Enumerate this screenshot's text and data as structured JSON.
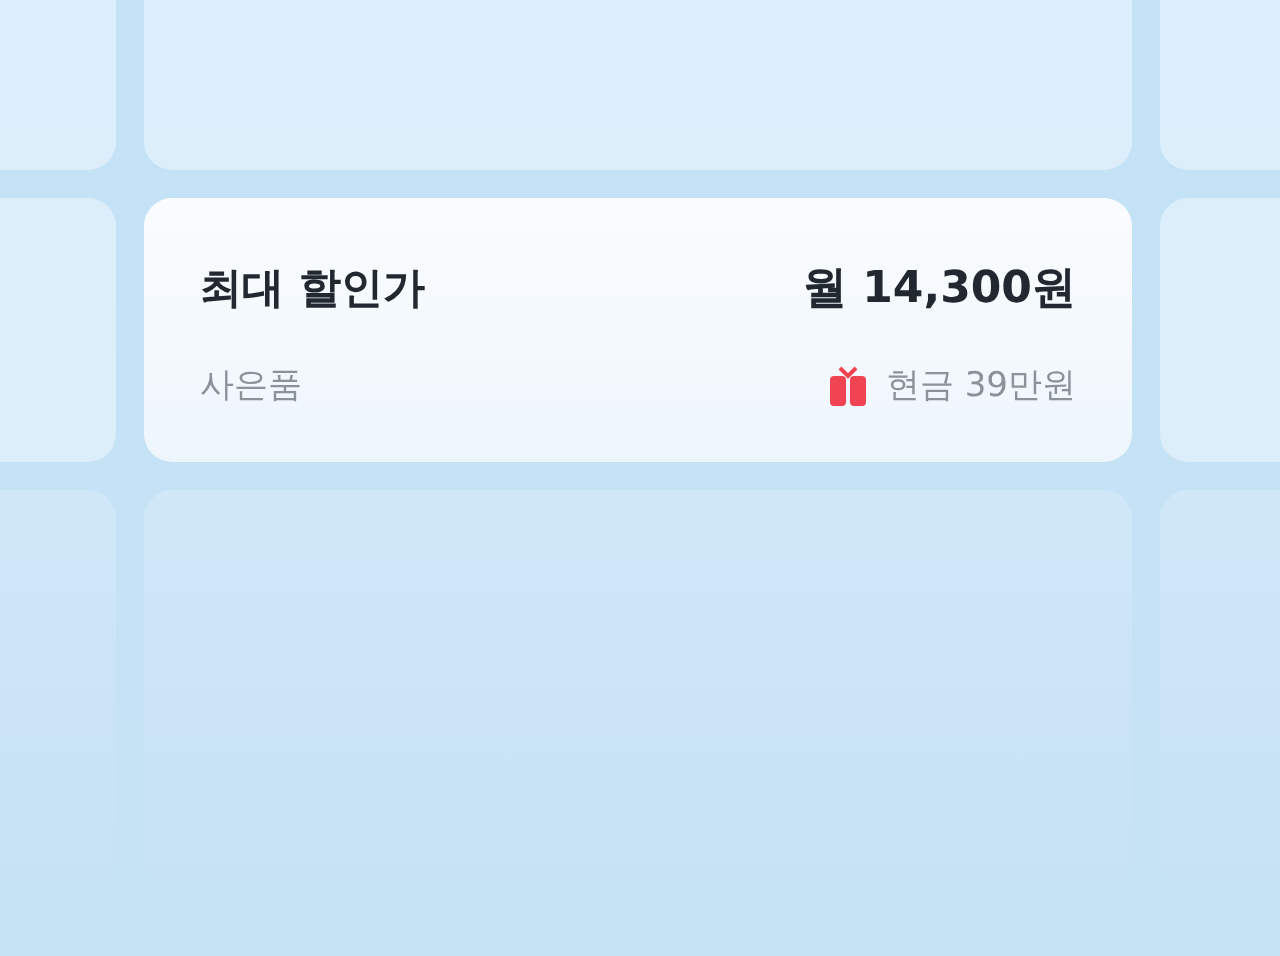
{
  "card": {
    "title": "최대 할인가",
    "price": "월 14,300원",
    "gift_label": "사은품",
    "gift_value": "현금 39만원"
  }
}
